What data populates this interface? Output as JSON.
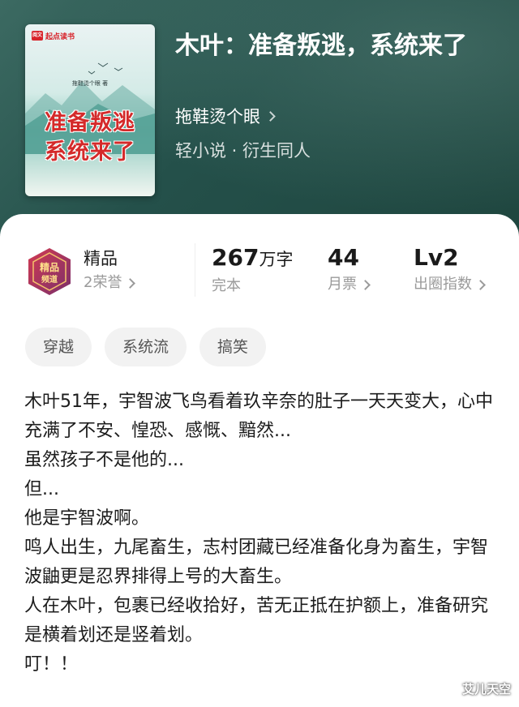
{
  "book": {
    "cover": {
      "publisher_badge": "起点读书",
      "badge_logo": "阅文",
      "author_line": "拖鞋烫个眼 著",
      "title_line1": "准备叛逃",
      "title_line2": "系统来了"
    },
    "title": "木叶：准备叛逃，系统来了",
    "author": "拖鞋烫个眼",
    "genre": "轻小说 · 衍生同人"
  },
  "stats": {
    "honor": {
      "badge_text": "精品频道",
      "label": "精品",
      "sub": "2荣誉"
    },
    "words": {
      "value": "267",
      "unit": "万字",
      "sub": "完本"
    },
    "tickets": {
      "value": "44",
      "sub": "月票"
    },
    "level": {
      "value": "Lv2",
      "sub": "出圈指数"
    }
  },
  "tags": [
    "穿越",
    "系统流",
    "搞笑"
  ],
  "description": [
    "木叶51年，宇智波飞鸟看着玖辛奈的肚子一天天变大，心中充满了不安、惶恐、感慨、黯然...",
    "虽然孩子不是他的...",
    "但...",
    "他是宇智波啊。",
    "鸣人出生，九尾畜生，志村团藏已经准备化身为畜生，宇智波鼬更是忍界排得上号的大畜生。",
    "人在木叶，包裹已经收拾好，苦无正抵在护额上，准备研究是横着划还是竖着划。",
    "叮！！"
  ],
  "watermark": "艾儿天空",
  "colors": {
    "hero_bg": "#24504a",
    "accent_red": "#d8232a",
    "tag_bg": "#f2f2f2"
  }
}
